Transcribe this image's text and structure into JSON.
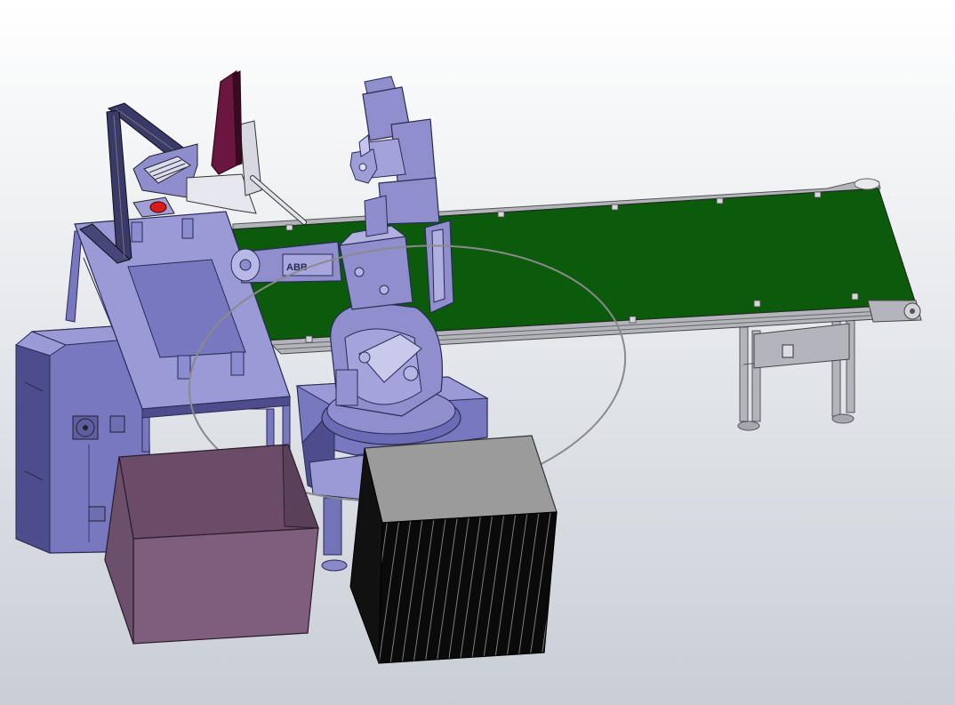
{
  "scene": {
    "viewport_background": {
      "top_color": "#ffffff",
      "bottom_color": "#c9ced6"
    },
    "colors": {
      "machine_body": "#7878c0",
      "machine_light": "#9a9ad6",
      "machine_dark": "#4d4d8e",
      "edge_line": "#2a2a55",
      "conveyor_belt": "#0c5a0c",
      "conveyor_frame": "#b4b4bc",
      "robot_body": "#8f8fcd",
      "monitor_screen": "#6b1640",
      "mouse": "#d81c1c",
      "open_box": "#7f5d7d",
      "pallet_top": "#9b9b9b",
      "pallet_side": "#0a0a0a",
      "workspace_ellipse": "#8a8a8a"
    },
    "robot_brand_label": "ABB"
  }
}
